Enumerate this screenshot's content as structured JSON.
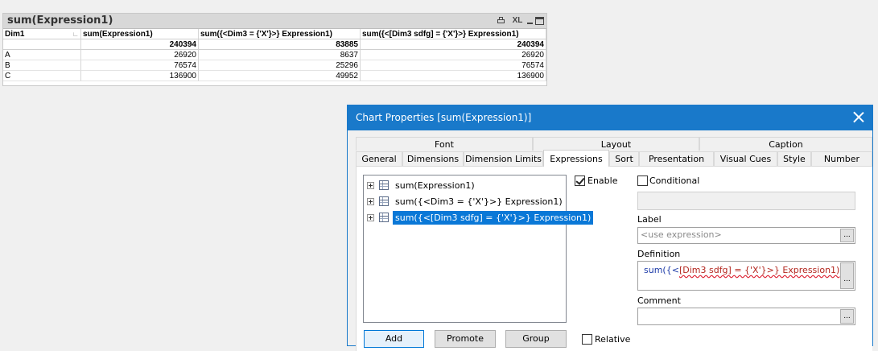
{
  "table": {
    "title": "sum(Expression1)",
    "toolbar": {
      "xl_label": "XL"
    },
    "columns": [
      "Dim1",
      "sum(Expression1)",
      "sum({<Dim3 = {'X'}>} Expression1)",
      "sum({<[Dim3 sdfg] = {'X'}>} Expression1)"
    ],
    "totals": [
      "",
      "240394",
      "83885",
      "240394"
    ],
    "rows": [
      [
        "A",
        "26920",
        "8637",
        "26920"
      ],
      [
        "B",
        "76574",
        "25296",
        "76574"
      ],
      [
        "C",
        "136900",
        "49952",
        "136900"
      ]
    ]
  },
  "dialog": {
    "title": "Chart Properties [sum(Expression1)]",
    "tabs_row1": [
      "Font",
      "Layout",
      "Caption"
    ],
    "tabs_row2": [
      "General",
      "Dimensions",
      "Dimension Limits",
      "Expressions",
      "Sort",
      "Presentation",
      "Visual Cues",
      "Style",
      "Number"
    ],
    "active_tab": "Expressions",
    "expressions": [
      "sum(Expression1)",
      "sum({<Dim3 = {'X'}>} Expression1)",
      "sum({<[Dim3 sdfg] = {'X'}>} Expression1)"
    ],
    "selected_expression_index": 2,
    "enable": {
      "label": "Enable",
      "checked": true
    },
    "conditional": {
      "label": "Conditional",
      "checked": false
    },
    "label_field": {
      "label": "Label",
      "placeholder": "<use expression>"
    },
    "definition": {
      "label": "Definition",
      "prefix": "sum({<",
      "error_part": "[Dim3 sdfg] = {'X'}>} Expression1)"
    },
    "comment": {
      "label": "Comment",
      "value": ""
    },
    "ellipsis": "...",
    "buttons": {
      "add": "Add",
      "promote": "Promote",
      "group": "Group"
    },
    "relative": {
      "label": "Relative",
      "checked": false
    }
  }
}
